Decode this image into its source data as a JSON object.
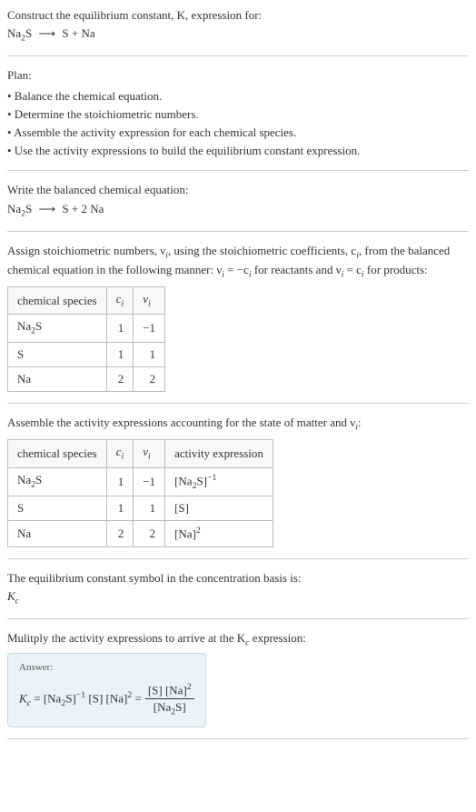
{
  "intro": {
    "line1": "Construct the equilibrium constant, K, expression for:",
    "eq_left": "Na",
    "eq_sub": "2",
    "eq_mid": "S",
    "arrow": "⟶",
    "eq_right": "S + Na"
  },
  "plan": {
    "heading": "Plan:",
    "items": [
      "• Balance the chemical equation.",
      "• Determine the stoichiometric numbers.",
      "• Assemble the activity expression for each chemical species.",
      "• Use the activity expressions to build the equilibrium constant expression."
    ]
  },
  "balanced": {
    "heading": "Write the balanced chemical equation:",
    "left1": "Na",
    "sub1": "2",
    "left2": "S",
    "arrow": "⟶",
    "right": "S + 2 Na"
  },
  "stoich": {
    "intro1": "Assign stoichiometric numbers, ν",
    "intro2": ", using the stoichiometric coefficients, c",
    "intro3": ", from the balanced chemical equation in the following manner: ν",
    "intro4": " = −c",
    "intro5": " for reactants and ν",
    "intro6": " = c",
    "intro7": " for products:",
    "sub_i": "i",
    "headers": [
      "chemical species",
      "cᵢ",
      "νᵢ"
    ],
    "rows": [
      {
        "species_a": "Na",
        "species_sub": "2",
        "species_b": "S",
        "c": "1",
        "v": "−1"
      },
      {
        "species_a": "S",
        "species_sub": "",
        "species_b": "",
        "c": "1",
        "v": "1"
      },
      {
        "species_a": "Na",
        "species_sub": "",
        "species_b": "",
        "c": "2",
        "v": "2"
      }
    ]
  },
  "activity": {
    "intro1": "Assemble the activity expressions accounting for the state of matter and ν",
    "intro2": ":",
    "sub_i": "i",
    "headers": [
      "chemical species",
      "cᵢ",
      "νᵢ",
      "activity expression"
    ],
    "rows": [
      {
        "species_a": "Na",
        "species_sub": "2",
        "species_b": "S",
        "c": "1",
        "v": "−1",
        "expr_pre": "[Na",
        "expr_sub": "2",
        "expr_mid": "S]",
        "expr_sup": "−1"
      },
      {
        "species_a": "S",
        "species_sub": "",
        "species_b": "",
        "c": "1",
        "v": "1",
        "expr_pre": "[S]",
        "expr_sub": "",
        "expr_mid": "",
        "expr_sup": ""
      },
      {
        "species_a": "Na",
        "species_sub": "",
        "species_b": "",
        "c": "2",
        "v": "2",
        "expr_pre": "[Na]",
        "expr_sub": "",
        "expr_mid": "",
        "expr_sup": "2"
      }
    ]
  },
  "symbol": {
    "line1": "The equilibrium constant symbol in the concentration basis is:",
    "K": "K",
    "sub": "c"
  },
  "multiply": {
    "line1": "Mulitply the activity expressions to arrive at the K",
    "sub": "c",
    "line2": " expression:"
  },
  "answer": {
    "label": "Answer:",
    "K": "K",
    "sub_c": "c",
    "eq": " = [Na",
    "sub2": "2",
    "part2": "S]",
    "sup_neg1": "−1",
    "part3": " [S] [Na]",
    "sup_2": "2",
    "eq2": " = ",
    "frac_num1": "[S] [Na]",
    "frac_num_sup": "2",
    "frac_den1": "[Na",
    "frac_den_sub": "2",
    "frac_den2": "S]"
  }
}
